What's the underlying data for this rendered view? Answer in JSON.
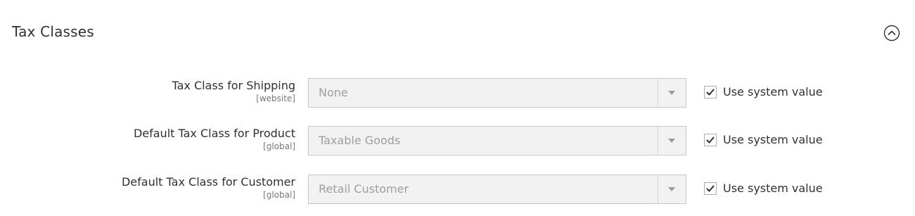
{
  "section": {
    "title": "Tax Classes",
    "collapse_icon": "chevron-up-circle-icon"
  },
  "rows": [
    {
      "label": "Tax Class for Shipping",
      "scope": "[website]",
      "selected": "None",
      "use_system_value_label": "Use system value",
      "use_system_value_checked": true
    },
    {
      "label": "Default Tax Class for Product",
      "scope": "[global]",
      "selected": "Taxable Goods",
      "use_system_value_label": "Use system value",
      "use_system_value_checked": true
    },
    {
      "label": "Default Tax Class for Customer",
      "scope": "[global]",
      "selected": "Retail Customer",
      "use_system_value_label": "Use system value",
      "use_system_value_checked": true
    }
  ],
  "colors": {
    "text": "#303030",
    "muted_text": "#9e9e9e",
    "disabled_bg": "#f2f2f2",
    "border": "#c7c7c7"
  }
}
